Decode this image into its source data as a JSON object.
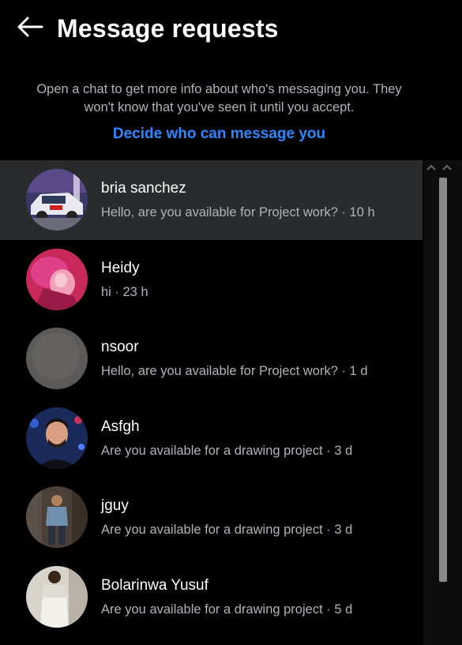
{
  "header": {
    "title": "Message requests"
  },
  "info_text": "Open a chat to get more info about who's messaging you. They won't know that you've seen it until you accept.",
  "decide_link": "Decide who can message you",
  "conversations": [
    {
      "name": "bria sanchez",
      "preview": "Hello, are you available for Project work? · 10 h",
      "active": true
    },
    {
      "name": "Heidy",
      "preview": "hi · 23 h",
      "active": false
    },
    {
      "name": "nsoor",
      "preview": "Hello, are you available for Project work? · 1 d",
      "active": false
    },
    {
      "name": "Asfgh",
      "preview": "Are you available for a drawing project · 3 d",
      "active": false
    },
    {
      "name": "jguy",
      "preview": "Are you available for a drawing project · 3 d",
      "active": false
    },
    {
      "name": "Bolarinwa Yusuf",
      "preview": "Are you available for a drawing project · 5 d",
      "active": false
    }
  ],
  "colors": {
    "background": "#000000",
    "accent": "#2d88ff",
    "active_row": "#2a2b2d",
    "secondary_text": "#b0b3b8"
  },
  "icons": {
    "back": "arrow-left-icon",
    "scroll_up": "chevron-up-icon"
  }
}
